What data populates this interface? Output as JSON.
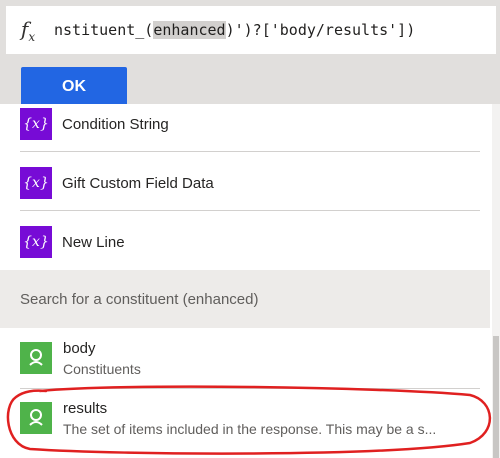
{
  "expression": {
    "prefix": "nstituent_(",
    "highlight": "enhanced",
    "suffix": ")')?['body/results'])"
  },
  "ok_label": "OK",
  "variables": [
    {
      "label": "Condition String",
      "icon": "variable-icon"
    },
    {
      "label": "Gift Custom Field Data",
      "icon": "variable-icon"
    },
    {
      "label": "New Line",
      "icon": "variable-icon"
    }
  ],
  "section_title": "Search for a constituent (enhanced)",
  "dynamic_items": [
    {
      "title": "body",
      "subtitle": "Constituents",
      "icon": "constituent-icon"
    },
    {
      "title": "results",
      "subtitle": "The set of items included in the response. This may be a s...",
      "icon": "constituent-icon"
    }
  ],
  "colors": {
    "accent": "#2266e3",
    "variable": "#770bd6",
    "connector": "#4fb34a",
    "annotation": "#e02020"
  }
}
